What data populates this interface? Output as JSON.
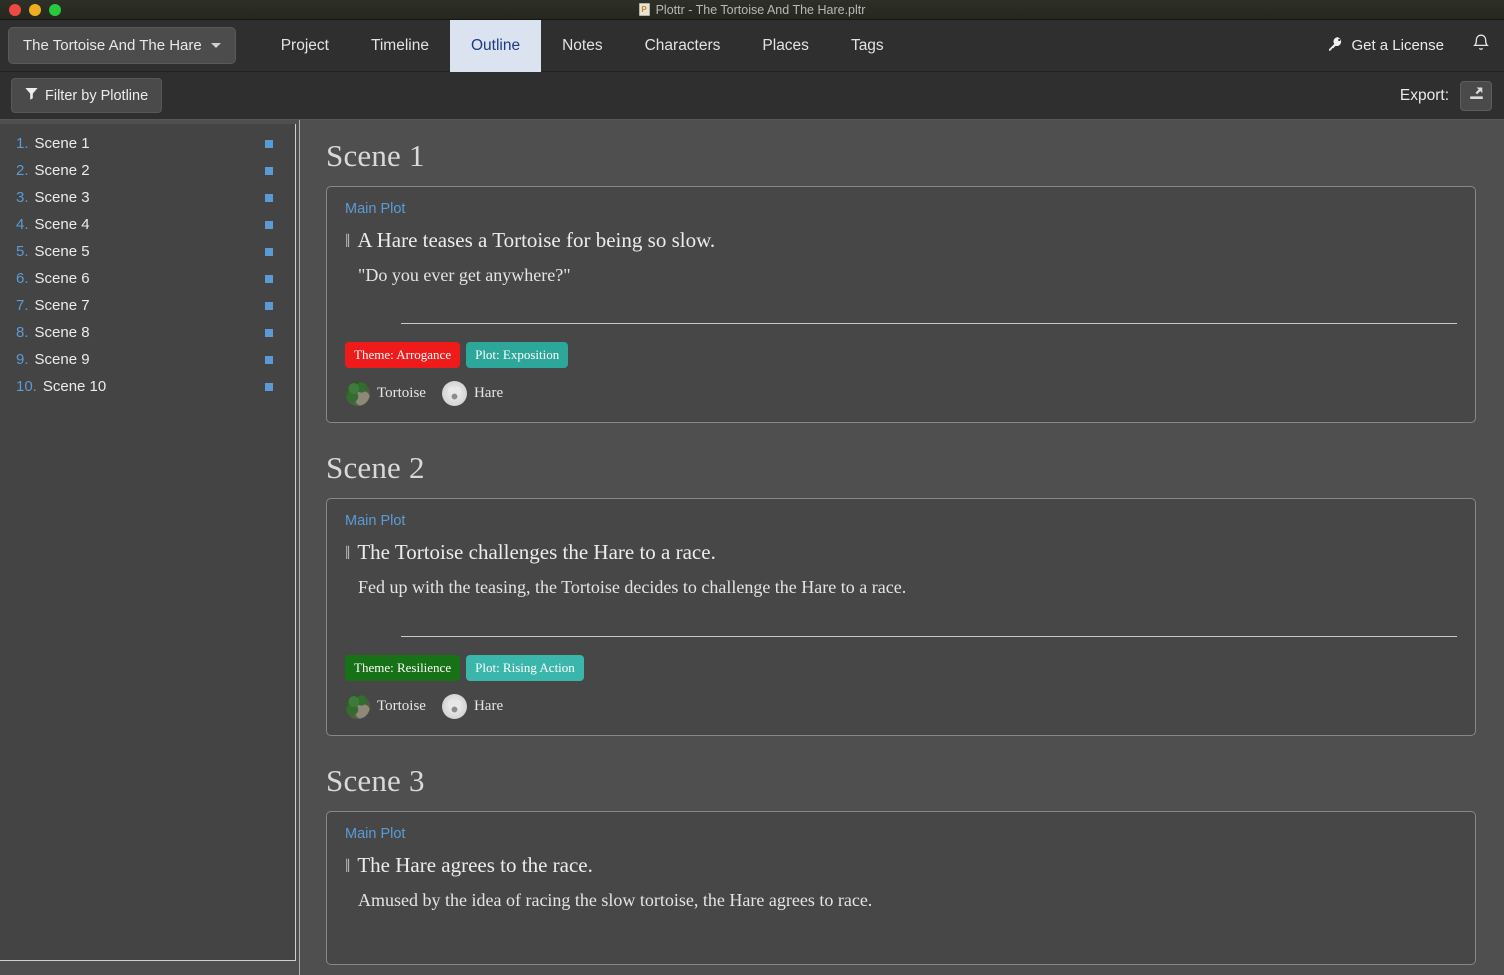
{
  "window": {
    "title": "Plottr - The Tortoise And The Hare.pltr",
    "doc_icon": "document-icon",
    "traffic_lights": [
      "close",
      "minimize",
      "zoom"
    ]
  },
  "navbar": {
    "project_button": "The Tortoise And The Hare",
    "tabs": [
      {
        "label": "Project",
        "active": false
      },
      {
        "label": "Timeline",
        "active": false
      },
      {
        "label": "Outline",
        "active": true
      },
      {
        "label": "Notes",
        "active": false
      },
      {
        "label": "Characters",
        "active": false
      },
      {
        "label": "Places",
        "active": false
      },
      {
        "label": "Tags",
        "active": false
      }
    ],
    "license_label": "Get a License",
    "license_icon": "key-icon",
    "notification_icon": "bell-icon"
  },
  "toolbar": {
    "filter_label": "Filter by Plotline",
    "filter_icon": "funnel-icon",
    "export_label": "Export:",
    "export_icon": "export-icon"
  },
  "sidebar": {
    "items": [
      {
        "num": "1.",
        "label": "Scene 1"
      },
      {
        "num": "2.",
        "label": "Scene 2"
      },
      {
        "num": "3.",
        "label": "Scene 3"
      },
      {
        "num": "4.",
        "label": "Scene 4"
      },
      {
        "num": "5.",
        "label": "Scene 5"
      },
      {
        "num": "6.",
        "label": "Scene 6"
      },
      {
        "num": "7.",
        "label": "Scene 7"
      },
      {
        "num": "8.",
        "label": "Scene 8"
      },
      {
        "num": "9.",
        "label": "Scene 9"
      },
      {
        "num": "10.",
        "label": "Scene 10"
      }
    ]
  },
  "main": {
    "scenes": [
      {
        "heading": "Scene 1",
        "plotline": "Main Plot",
        "title": "A Hare teases a Tortoise for being so slow.",
        "description": "\"Do you ever get anywhere?\"",
        "tags": [
          {
            "label": "Theme: Arrogance",
            "color": "#ef1b1b"
          },
          {
            "label": "Plot: Exposition",
            "color": "#2ca79a"
          }
        ],
        "characters": [
          {
            "name": "Tortoise",
            "avatar": "tortoise"
          },
          {
            "name": "Hare",
            "avatar": "hare"
          }
        ]
      },
      {
        "heading": "Scene 2",
        "plotline": "Main Plot",
        "title": "The Tortoise challenges the Hare to a race.",
        "description": "Fed up with the teasing, the Tortoise decides to challenge the Hare to a race.",
        "tags": [
          {
            "label": "Theme: Resilience",
            "color": "#177117"
          },
          {
            "label": "Plot: Rising Action",
            "color": "#3bb6ab"
          }
        ],
        "characters": [
          {
            "name": "Tortoise",
            "avatar": "tortoise"
          },
          {
            "name": "Hare",
            "avatar": "hare"
          }
        ]
      },
      {
        "heading": "Scene 3",
        "plotline": "Main Plot",
        "title": "The Hare agrees to the race.",
        "description": "Amused by the idea of racing the slow tortoise, the Hare agrees to race.",
        "tags": [],
        "characters": []
      }
    ]
  },
  "colors": {
    "accent_blue": "#5b9bd5",
    "active_tab_bg": "#dce3f0",
    "active_tab_fg": "#1f3b80",
    "page_bg": "#4f4f4f",
    "card_bg": "#474747",
    "sidebar_bg": "#444444"
  }
}
